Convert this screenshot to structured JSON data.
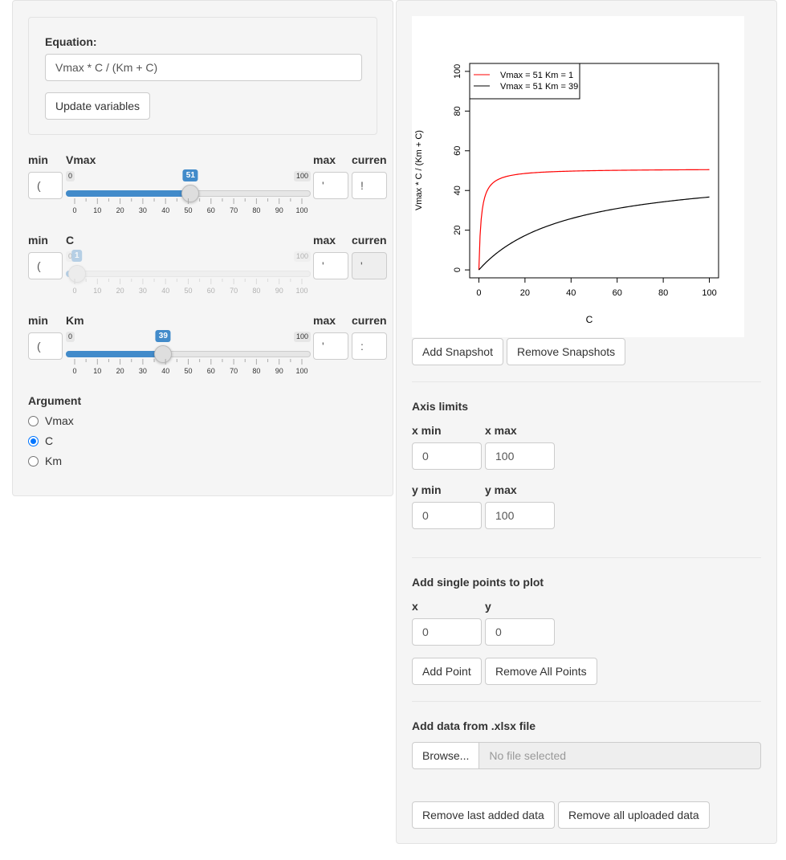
{
  "equation": {
    "label": "Equation:",
    "value": "Vmax * C / (Km + C)",
    "update_button": "Update variables"
  },
  "variables": [
    {
      "min_label": "min",
      "name": "Vmax",
      "max_label": "max",
      "current_label": "curren",
      "min_value": "(",
      "max_value": "'",
      "current_value": "!",
      "slider_min": 0,
      "slider_max": 100,
      "slider_value": 51,
      "min_text": "0",
      "max_text": "100",
      "value_text": "51",
      "tick_labels": [
        "0",
        "10",
        "20",
        "30",
        "40",
        "50",
        "60",
        "70",
        "80",
        "90",
        "100"
      ],
      "disabled": false
    },
    {
      "min_label": "min",
      "name": "C",
      "max_label": "max",
      "current_label": "curren",
      "min_value": "(",
      "max_value": "'",
      "current_value": "'",
      "slider_min": 0,
      "slider_max": 100,
      "slider_value": 1,
      "min_text": "0",
      "max_text": "100",
      "value_text": "1",
      "tick_labels": [
        "0",
        "10",
        "20",
        "30",
        "40",
        "50",
        "60",
        "70",
        "80",
        "90",
        "100"
      ],
      "disabled": true
    },
    {
      "min_label": "min",
      "name": "Km",
      "max_label": "max",
      "current_label": "curren",
      "min_value": "(",
      "max_value": "'",
      "current_value": ":",
      "slider_min": 0,
      "slider_max": 100,
      "slider_value": 39,
      "min_text": "0",
      "max_text": "100",
      "value_text": "39",
      "tick_labels": [
        "0",
        "10",
        "20",
        "30",
        "40",
        "50",
        "60",
        "70",
        "80",
        "90",
        "100"
      ],
      "disabled": false
    }
  ],
  "argument": {
    "label": "Argument",
    "options": [
      "Vmax",
      "C",
      "Km"
    ],
    "selected": "C"
  },
  "chart_data": {
    "type": "line",
    "xlabel": "C",
    "ylabel": "Vmax * C / (Km + C)",
    "xlim": [
      0,
      100
    ],
    "ylim": [
      0,
      100
    ],
    "x_ticks": [
      "0",
      "20",
      "40",
      "60",
      "80",
      "100"
    ],
    "y_ticks": [
      "0",
      "20",
      "40",
      "60",
      "80",
      "100"
    ],
    "legend_position": "top-left",
    "series": [
      {
        "name": "Vmax = 51 Km = 1",
        "color": "#ff0000",
        "vmax": 51,
        "km": 1,
        "x": [
          0,
          1,
          2,
          5,
          10,
          20,
          40,
          60,
          80,
          100
        ],
        "y": [
          0,
          25.5,
          34,
          42.5,
          46.4,
          48.6,
          49.8,
          50.2,
          50.4,
          50.5
        ]
      },
      {
        "name": "Vmax = 51 Km = 39",
        "color": "#000000",
        "vmax": 51,
        "km": 39,
        "x": [
          0,
          5,
          10,
          20,
          40,
          60,
          80,
          100
        ],
        "y": [
          0,
          5.8,
          10.4,
          17.0,
          25.8,
          31.0,
          34.3,
          36.7
        ]
      }
    ]
  },
  "snapshot": {
    "add_label": "Add Snapshot",
    "remove_label": "Remove Snapshots"
  },
  "axis_limits": {
    "title": "Axis limits",
    "xmin_label": "x min",
    "xmax_label": "x max",
    "ymin_label": "y min",
    "ymax_label": "y max",
    "xmin": "0",
    "xmax": "100",
    "ymin": "0",
    "ymax": "100"
  },
  "points": {
    "title": "Add single points to plot",
    "x_label": "x",
    "y_label": "y",
    "x": "0",
    "y": "0",
    "add_label": "Add Point",
    "remove_label": "Remove All Points"
  },
  "file_upload": {
    "title": "Add data from .xlsx file",
    "browse_label": "Browse...",
    "status": "No file selected",
    "remove_last_label": "Remove last added data",
    "remove_all_label": "Remove all uploaded data"
  }
}
